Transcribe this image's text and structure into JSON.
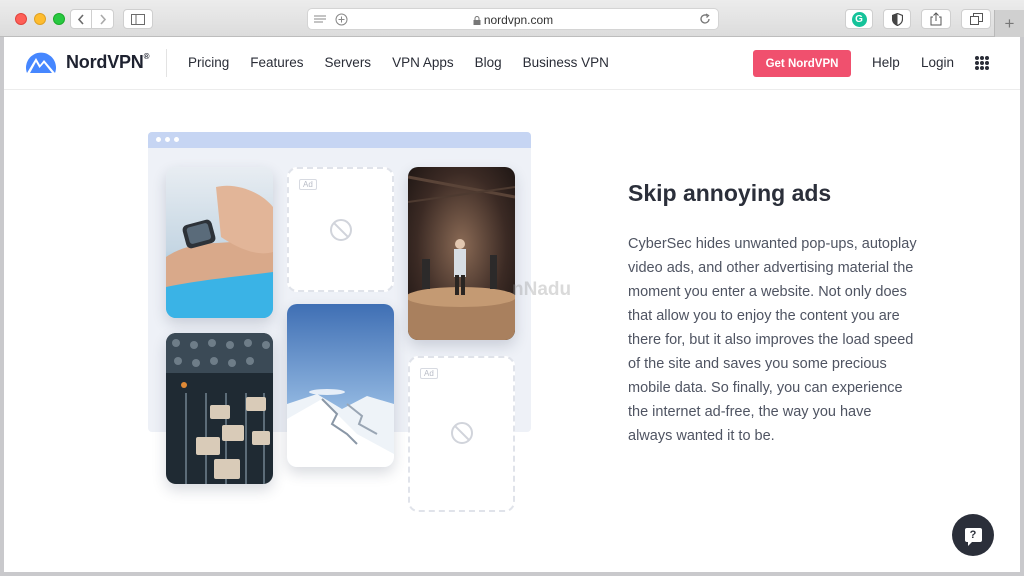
{
  "browser": {
    "url": "nordvpn.com",
    "lock_icon": "lock-icon",
    "colors": {
      "close": "#fe5f57",
      "minimize": "#febc2e",
      "maximize": "#28c840"
    }
  },
  "nav": {
    "logo_text": "NordVPN",
    "logo_reg": "®",
    "links": [
      "Pricing",
      "Features",
      "Servers",
      "VPN Apps",
      "Blog",
      "Business VPN"
    ],
    "cta": "Get NordVPN",
    "help": "Help",
    "login": "Login",
    "accent_color": "#f0506e"
  },
  "illustration": {
    "ad_label": "Ad"
  },
  "content": {
    "headline": "Skip annoying ads",
    "body": "CyberSec hides unwanted pop-ups, autoplay video ads, and other advertising material the moment you enter a website. Not only does that allow you to enjoy the content you are there for, but it also improves the load speed of the site and saves you some precious mobile data. So finally, you can experience the internet ad-free, the way you have always wanted it to be."
  },
  "watermark": "nNadu",
  "support_icon": "question-chat-icon"
}
